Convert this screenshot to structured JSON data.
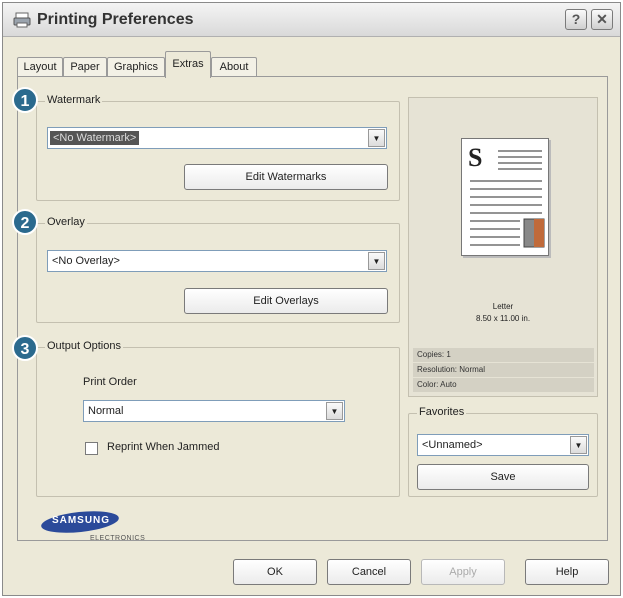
{
  "window": {
    "title": "Printing Preferences",
    "help_button": "?",
    "close_button": "✕"
  },
  "tabs": [
    {
      "label": "Layout"
    },
    {
      "label": "Paper"
    },
    {
      "label": "Graphics"
    },
    {
      "label": "Extras",
      "active": true
    },
    {
      "label": "About"
    }
  ],
  "watermark": {
    "number": "1",
    "label": "Watermark",
    "selected": "<No Watermark>",
    "edit_button": "Edit Watermarks"
  },
  "overlay": {
    "number": "2",
    "label": "Overlay",
    "selected": "<No Overlay>",
    "edit_button": "Edit Overlays"
  },
  "output": {
    "number": "3",
    "label": "Output Options",
    "print_order_label": "Print Order",
    "print_order_value": "Normal",
    "reprint_label": "Reprint When Jammed",
    "reprint_checked": false
  },
  "preview": {
    "letter_glyph": "S",
    "paper_name": "Letter",
    "paper_size": "8.50 x 11.00 in.",
    "copies": "Copies: 1",
    "resolution": "Resolution: Normal",
    "color": "Color: Auto"
  },
  "favorites": {
    "label": "Favorites",
    "selected": "<Unnamed>",
    "save_button": "Save"
  },
  "logo": {
    "brand": "SAMSUNG",
    "sub": "ELECTRONICS"
  },
  "footer": {
    "ok": "OK",
    "cancel": "Cancel",
    "apply": "Apply",
    "help": "Help"
  },
  "colors": {
    "badge": "#2b6a8e",
    "dialog_bg": "#ece9d8"
  }
}
